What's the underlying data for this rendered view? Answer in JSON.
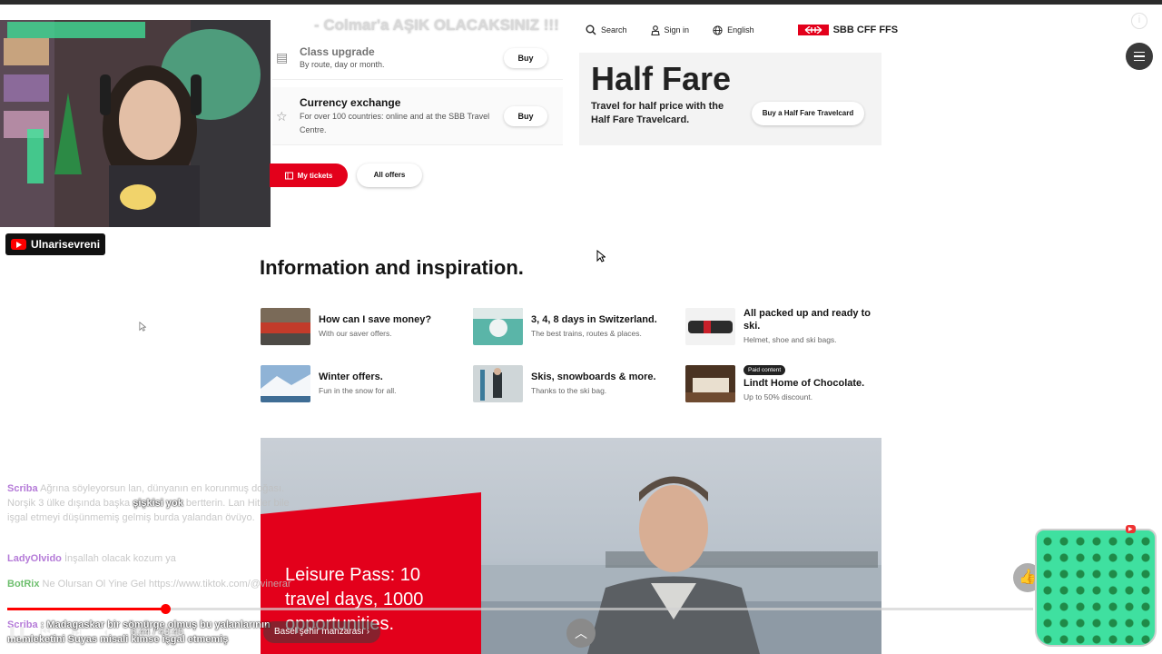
{
  "video": {
    "title": "- Colmar'a AŞIK OLACAKSINIZ !!!",
    "channel": "Ulnarisevreni",
    "time_current": "6:44",
    "time_total": "43:45",
    "time_separator": " / ",
    "chapter": "Basel şehir manzarası",
    "progress_fraction": 0.154
  },
  "header": {
    "search_label": "Search",
    "signin_label": "Sign in",
    "language_label": "English",
    "logo_text": "SBB CFF FFS"
  },
  "offers": [
    {
      "title": "Class upgrade",
      "desc": "By route, day or month.",
      "buy_label": "Buy"
    },
    {
      "title": "Currency exchange",
      "desc": "For over 100 countries: online and at the SBB Travel Centre.",
      "buy_label": "Buy"
    }
  ],
  "half_fare": {
    "title": "Half Fare",
    "subtitle": "Travel for half price with the Half Fare Travelcard.",
    "button": "Buy a Half Fare Travelcard"
  },
  "actions": {
    "my_tickets": "My tickets",
    "all_offers": "All offers"
  },
  "info": {
    "title": "Information and inspiration.",
    "items": [
      {
        "title": "How can I save money?",
        "sub": "With our saver offers."
      },
      {
        "title": "3, 4, 8 days in Switzerland.",
        "sub": "The best trains, routes & places."
      },
      {
        "title": "All packed up and ready to ski.",
        "sub": "Helmet, shoe and ski bags."
      },
      {
        "title": "Winter offers.",
        "sub": "Fun in the snow for all."
      },
      {
        "title": "Skis, snowboards & more.",
        "sub": "Thanks to the ski bag."
      },
      {
        "badge": "Paid content",
        "title": "Lindt Home of Chocolate.",
        "sub": "Up to 50% discount."
      }
    ]
  },
  "hero": {
    "text": "Leisure Pass: 10 travel days, 1000 opportunities."
  },
  "chat": [
    {
      "name": "Scriba",
      "text": "Ağrına söyleyorsun lan, dünyanın en korunmuş doğası. Norşik 3 ülke dışında başka",
      "highlight": "şişkisi yok",
      "text2": "bertterin. Lan Hitler bile işgal etmeyi düşünmemiş gelmiş burda yalandan övüyo."
    },
    {
      "name": "LadyOlvido",
      "text": "İnşallah olacak kozum ya"
    },
    {
      "name": "BotRix",
      "text": "Ne Olursan Ol Yine Gel https://www.tiktok.com/@vinerar"
    },
    {
      "name": "Scriba",
      "text": ": Madagaskar bir sömürge olmuş bu yalanlarının memleketini Suyas misali kimse işgal etmemiş"
    }
  ],
  "icons": {
    "search": "search-icon",
    "user": "user-icon",
    "globe": "globe-icon",
    "menu": "menu-icon"
  },
  "colors": {
    "sbb_red": "#e3001b",
    "yt_red": "#ff0000"
  }
}
